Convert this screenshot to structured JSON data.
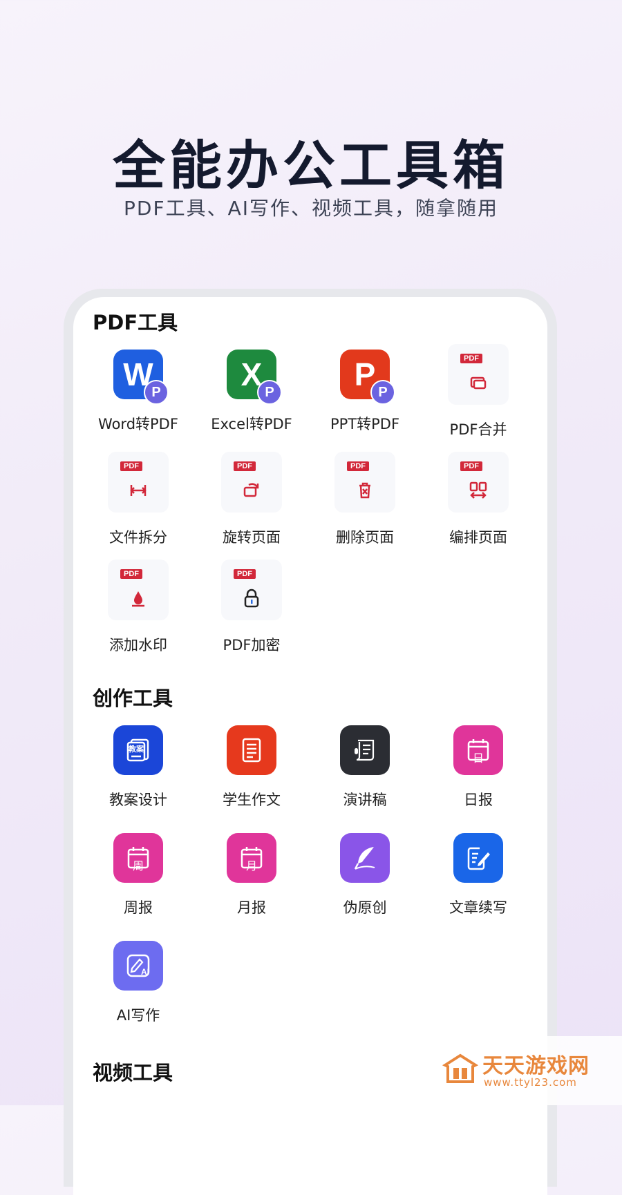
{
  "hero": {
    "title": "全能办公工具箱",
    "subtitle": "PDF工具、AI写作、视频工具，随拿随用"
  },
  "sections": {
    "pdf": {
      "title": "PDF工具",
      "items": [
        {
          "label": "Word转PDF",
          "icon": "word-to-pdf-icon",
          "letter": "W",
          "badge": "P",
          "color": "#1f5fe0"
        },
        {
          "label": "Excel转PDF",
          "icon": "excel-to-pdf-icon",
          "letter": "X",
          "badge": "P",
          "color": "#1e8a3e"
        },
        {
          "label": "PPT转PDF",
          "icon": "ppt-to-pdf-icon",
          "letter": "P",
          "badge": "P",
          "color": "#e2391c"
        },
        {
          "label": "PDF合并",
          "icon": "pdf-merge-icon",
          "tag": "PDF"
        },
        {
          "label": "文件拆分",
          "icon": "file-split-icon",
          "tag": "PDF"
        },
        {
          "label": "旋转页面",
          "icon": "rotate-page-icon",
          "tag": "PDF"
        },
        {
          "label": "删除页面",
          "icon": "delete-page-icon",
          "tag": "PDF"
        },
        {
          "label": "编排页面",
          "icon": "arrange-pages-icon",
          "tag": "PDF"
        },
        {
          "label": "添加水印",
          "icon": "watermark-drop-icon",
          "tag": "PDF"
        },
        {
          "label": "PDF加密",
          "icon": "lock-icon",
          "tag": "PDF"
        }
      ]
    },
    "create": {
      "title": "创作工具",
      "items": [
        {
          "label": "教案设计",
          "icon": "lesson-plan-icon",
          "color": "#1b46d8",
          "glyph_text": "教案"
        },
        {
          "label": "学生作文",
          "icon": "essay-document-icon",
          "color": "#e6391d"
        },
        {
          "label": "演讲稿",
          "icon": "speech-scroll-icon",
          "color": "#2b2d33"
        },
        {
          "label": "日报",
          "icon": "daily-calendar-icon",
          "color": "#e0359a",
          "glyph_text": "日"
        },
        {
          "label": "周报",
          "icon": "weekly-calendar-icon",
          "color": "#e0359a",
          "glyph_text": "周"
        },
        {
          "label": "月报",
          "icon": "monthly-calendar-icon",
          "color": "#e0359a",
          "glyph_text": "月"
        },
        {
          "label": "伪原创",
          "icon": "quill-feather-icon",
          "color": "#8a55e8"
        },
        {
          "label": "文章续写",
          "icon": "article-edit-icon",
          "color": "#1a66e8"
        },
        {
          "label": "AI写作",
          "icon": "ai-writing-icon",
          "color": "#6d6cf0",
          "glyph_text": "AI"
        }
      ]
    },
    "video": {
      "title": "视频工具"
    }
  },
  "watermark": {
    "name": "天天游戏网",
    "url": "www.ttyl23.com"
  },
  "colors": {
    "pdf_red": "#d2283a",
    "badge_purple": "#6b63e0",
    "watermark_orange": "#e8873c"
  }
}
